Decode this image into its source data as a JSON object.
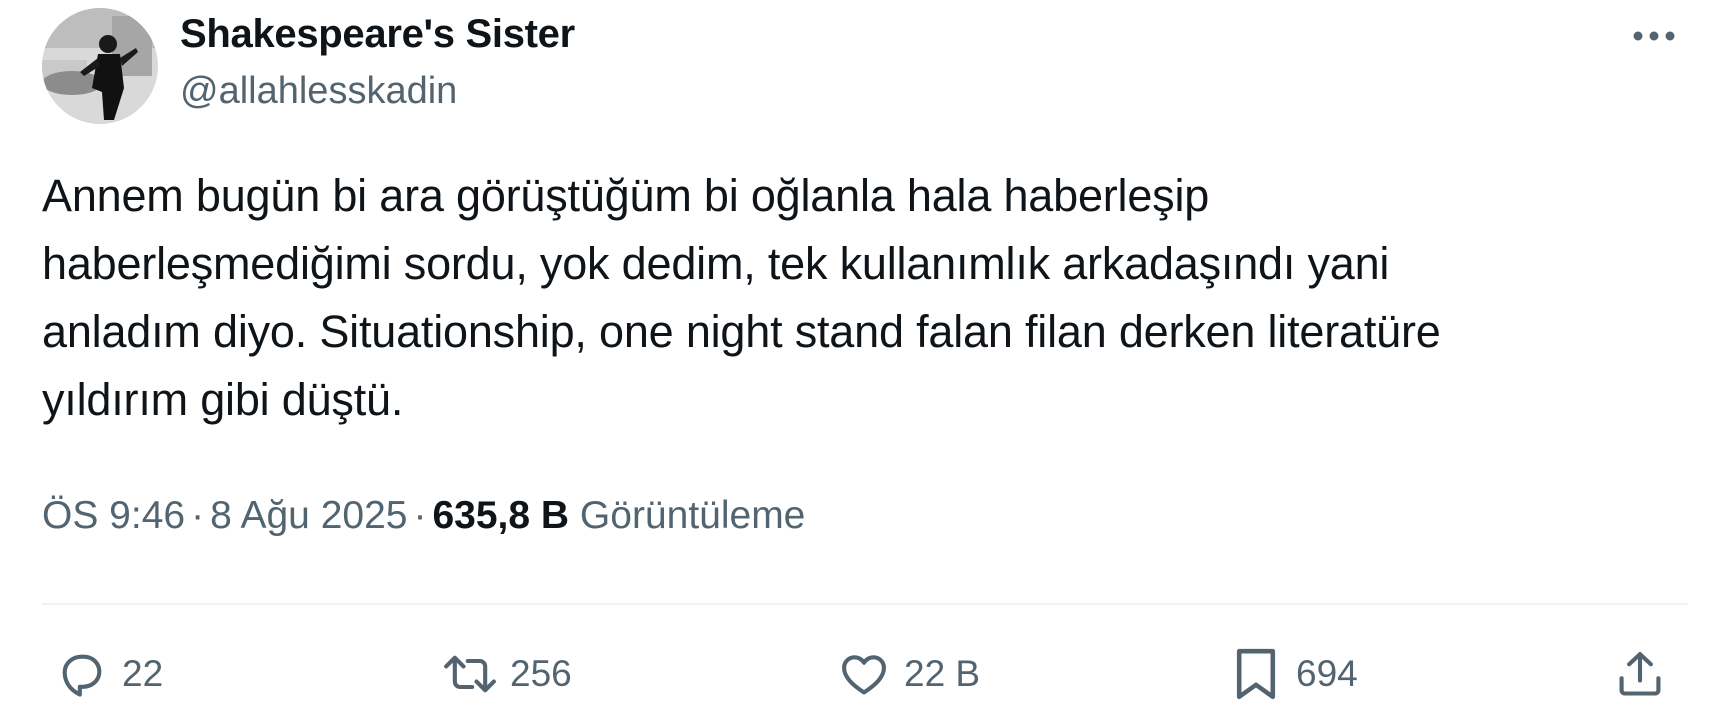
{
  "tweet": {
    "author": {
      "display_name": "Shakespeare's Sister",
      "handle": "@allahlesskadin"
    },
    "text": "Annem bugün bi ara görüştüğüm bi oğlanla hala haberleşip\nhaberleşmediğimi sordu, yok dedim, tek kullanımlık arkadaşındı yani\nanladım diyo. Situationship, one night stand falan filan derken literatüre\nyıldırım gibi düştü.",
    "time": "ÖS 9:46",
    "separator": "·",
    "date": "8 Ağu 2025",
    "views_count": "635,8 B",
    "views_label": "Görüntüleme"
  },
  "actions": {
    "reply": {
      "icon": "reply-icon",
      "count": "22"
    },
    "retweet": {
      "icon": "retweet-icon",
      "count": "256"
    },
    "like": {
      "icon": "heart-icon",
      "count": "22 B"
    },
    "bookmark": {
      "icon": "bookmark-icon",
      "count": "694"
    },
    "share": {
      "icon": "share-icon"
    }
  },
  "colors": {
    "text_primary": "#0f1419",
    "text_secondary": "#536471",
    "divider": "#eff3f4"
  }
}
